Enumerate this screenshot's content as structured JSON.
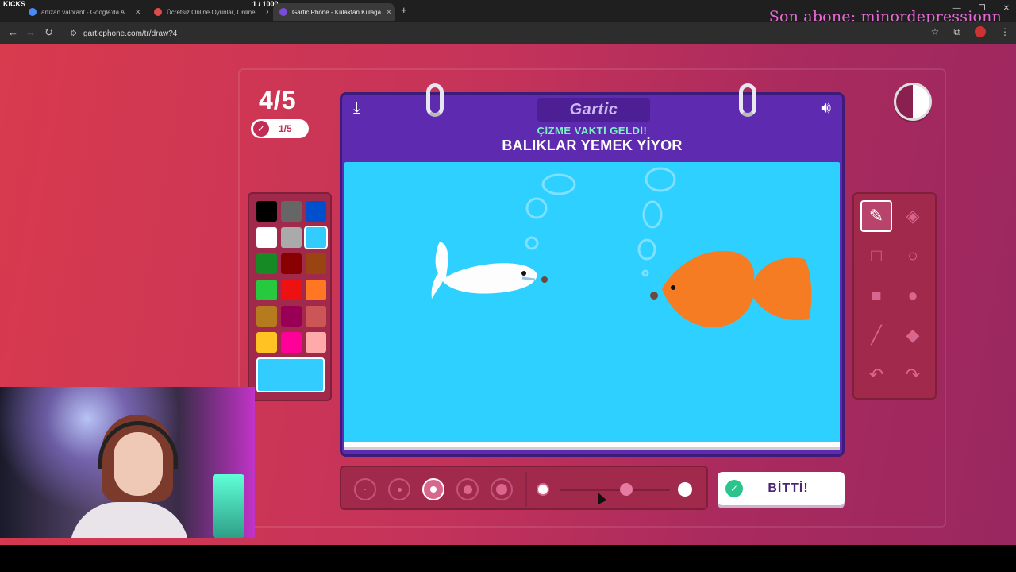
{
  "stream": {
    "tag": "KICKS",
    "counter": "1 / 1000",
    "sub_banner": "Son abone: minordepressionn"
  },
  "browser": {
    "tabs": [
      {
        "label": "artizan valorant - Google'da A...",
        "favicon_color": "#4a8af4",
        "active": false
      },
      {
        "label": "Ücretsiz Online Oyunlar, Online...",
        "favicon_color": "#e04b4b",
        "active": false
      },
      {
        "label": "Gartic Phone - Kulaktan Kulağa",
        "favicon_color": "#7a4bd6",
        "active": true
      }
    ],
    "url": "garticphone.com/tr/draw?4"
  },
  "game": {
    "round": "4/5",
    "ready_count": "1/5",
    "prompt_label": "ÇİZME VAKTİ GELDİ!",
    "prompt_text": "BALIKLAR YEMEK YİYOR",
    "logo": "Gartic",
    "done_button": "BİTTİ!",
    "timer_elapsed_fraction": 0.5
  },
  "palette": {
    "colors": [
      "#000000",
      "#666666",
      "#0050cd",
      "#ffffff",
      "#aaaaaa",
      "#33ccff",
      "#158a25",
      "#880000",
      "#994411",
      "#27c93f",
      "#ee1111",
      "#ff7722",
      "#b57b1e",
      "#990055",
      "#cc5555",
      "#ffc222",
      "#ff0099",
      "#ffaaaa"
    ],
    "selected": "#33ccff"
  },
  "tools": [
    {
      "name": "pen-icon",
      "selected": true
    },
    {
      "name": "eraser-icon",
      "selected": false
    },
    {
      "name": "rectangle-outline-icon",
      "selected": false
    },
    {
      "name": "circle-outline-icon",
      "selected": false
    },
    {
      "name": "rectangle-filled-icon",
      "selected": false
    },
    {
      "name": "circle-filled-icon",
      "selected": false
    },
    {
      "name": "line-icon",
      "selected": false
    },
    {
      "name": "fill-bucket-icon",
      "selected": false
    },
    {
      "name": "undo-icon",
      "selected": false
    },
    {
      "name": "redo-icon",
      "selected": false
    }
  ],
  "brush_sizes": {
    "count": 5,
    "selected_index": 2
  },
  "opacity_level": 0.6
}
